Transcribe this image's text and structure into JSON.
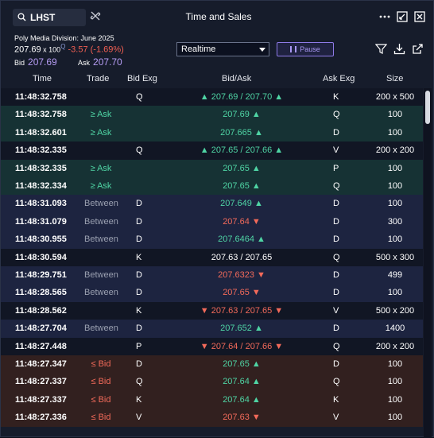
{
  "window": {
    "title": "Time and Sales",
    "symbol": "LHST"
  },
  "quote": {
    "name": "Poly Media Division: June 2025",
    "last": "207.69",
    "last_size": "100",
    "change": "-3.57 (-1.69%)",
    "bid_label": "Bid",
    "bid": "207.69",
    "ask_label": "Ask",
    "ask": "207.70"
  },
  "toolbar": {
    "mode": "Realtime",
    "pause_label": "Pause"
  },
  "columns": [
    "Time",
    "Trade",
    "Bid Exg",
    "Bid/Ask",
    "Ask Exg",
    "Size"
  ],
  "rows": [
    {
      "type": "neutral",
      "time": "11:48:32.758",
      "trade": "",
      "bidx": "Q",
      "price": "",
      "bid": "207.69",
      "ask": "207.70",
      "dir": "up",
      "askx": "K",
      "size": "200 x 500"
    },
    {
      "type": "ask",
      "time": "11:48:32.758",
      "trade": "≥ Ask",
      "bidx": "",
      "price": "207.69",
      "bid": "",
      "ask": "",
      "dir": "up",
      "askx": "Q",
      "size": "100"
    },
    {
      "type": "ask",
      "time": "11:48:32.601",
      "trade": "≥ Ask",
      "bidx": "",
      "price": "207.665",
      "bid": "",
      "ask": "",
      "dir": "up",
      "askx": "D",
      "size": "100"
    },
    {
      "type": "neutral",
      "time": "11:48:32.335",
      "trade": "",
      "bidx": "Q",
      "price": "",
      "bid": "207.65",
      "ask": "207.66",
      "dir": "up",
      "askx": "V",
      "size": "200 x 200"
    },
    {
      "type": "ask",
      "time": "11:48:32.335",
      "trade": "≥ Ask",
      "bidx": "",
      "price": "207.65",
      "bid": "",
      "ask": "",
      "dir": "up",
      "askx": "P",
      "size": "100"
    },
    {
      "type": "ask",
      "time": "11:48:32.334",
      "trade": "≥ Ask",
      "bidx": "",
      "price": "207.65",
      "bid": "",
      "ask": "",
      "dir": "up",
      "askx": "Q",
      "size": "100"
    },
    {
      "type": "between",
      "time": "11:48:31.093",
      "trade": "Between",
      "bidx": "D",
      "price": "207.649",
      "bid": "",
      "ask": "",
      "dir": "up",
      "askx": "D",
      "size": "100"
    },
    {
      "type": "between",
      "time": "11:48:31.079",
      "trade": "Between",
      "bidx": "D",
      "price": "207.64",
      "bid": "",
      "ask": "",
      "dir": "dn",
      "askx": "D",
      "size": "300"
    },
    {
      "type": "between",
      "time": "11:48:30.955",
      "trade": "Between",
      "bidx": "D",
      "price": "207.6464",
      "bid": "",
      "ask": "",
      "dir": "up",
      "askx": "D",
      "size": "100"
    },
    {
      "type": "neutral",
      "time": "11:48:30.594",
      "trade": "",
      "bidx": "K",
      "price": "",
      "bid": "207.63",
      "ask": "207.65",
      "dir": "none",
      "askx": "Q",
      "size": "500 x 300"
    },
    {
      "type": "between",
      "time": "11:48:29.751",
      "trade": "Between",
      "bidx": "D",
      "price": "207.6323",
      "bid": "",
      "ask": "",
      "dir": "dn",
      "askx": "D",
      "size": "499"
    },
    {
      "type": "between",
      "time": "11:48:28.565",
      "trade": "Between",
      "bidx": "D",
      "price": "207.65",
      "bid": "",
      "ask": "",
      "dir": "dn",
      "askx": "D",
      "size": "100"
    },
    {
      "type": "neutral",
      "time": "11:48:28.562",
      "trade": "",
      "bidx": "K",
      "price": "",
      "bid": "207.63",
      "ask": "207.65",
      "dir": "dn",
      "askx": "V",
      "size": "500 x 200"
    },
    {
      "type": "between",
      "time": "11:48:27.704",
      "trade": "Between",
      "bidx": "D",
      "price": "207.652",
      "bid": "",
      "ask": "",
      "dir": "up",
      "askx": "D",
      "size": "1400"
    },
    {
      "type": "neutral",
      "time": "11:48:27.448",
      "trade": "",
      "bidx": "P",
      "price": "",
      "bid": "207.64",
      "ask": "207.66",
      "dir": "dn",
      "askx": "Q",
      "size": "200 x 200"
    },
    {
      "type": "bid",
      "time": "11:48:27.347",
      "trade": "≤ Bid",
      "bidx": "D",
      "price": "207.65",
      "bid": "",
      "ask": "",
      "dir": "up",
      "askx": "D",
      "size": "100"
    },
    {
      "type": "bid",
      "time": "11:48:27.337",
      "trade": "≤ Bid",
      "bidx": "Q",
      "price": "207.64",
      "bid": "",
      "ask": "",
      "dir": "up",
      "askx": "Q",
      "size": "100"
    },
    {
      "type": "bid",
      "time": "11:48:27.337",
      "trade": "≤ Bid",
      "bidx": "K",
      "price": "207.64",
      "bid": "",
      "ask": "",
      "dir": "up",
      "askx": "K",
      "size": "100"
    },
    {
      "type": "bid",
      "time": "11:48:27.336",
      "trade": "≤ Bid",
      "bidx": "V",
      "price": "207.63",
      "bid": "",
      "ask": "",
      "dir": "dn",
      "askx": "V",
      "size": "100"
    }
  ],
  "colors": {
    "up": "#4fd4a4",
    "down": "#f26a5a",
    "accent": "#a897f2"
  }
}
